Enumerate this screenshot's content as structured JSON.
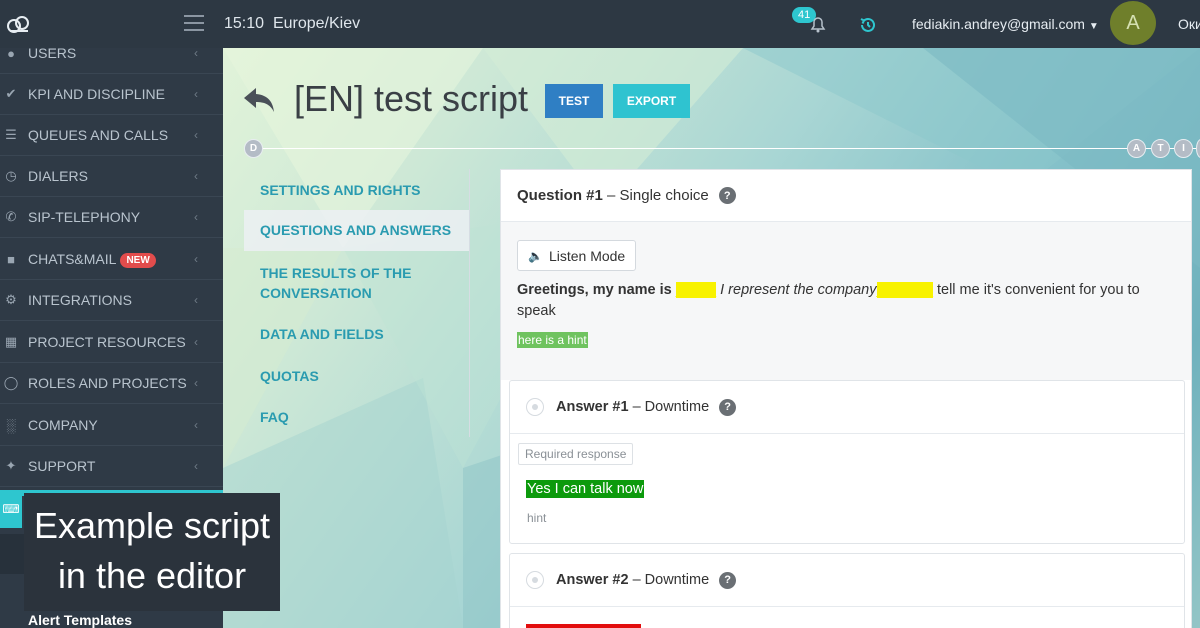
{
  "topbar": {
    "time": "15:10",
    "timezone": "Europe/Kiev",
    "notifications_count": "41",
    "user_email": "fediakin.andrey@gmail.com",
    "avatar_letter": "A",
    "extra_text": "Оки",
    "icons": [
      "cloud-logo-icon",
      "hamburger-icon",
      "bell-icon",
      "history-icon",
      "chevron-down-icon"
    ]
  },
  "sidebar": {
    "items": [
      {
        "label": "USERS",
        "icon": "user-icon"
      },
      {
        "label": "KPI AND DISCIPLINE",
        "icon": "check-icon"
      },
      {
        "label": "QUEUES AND CALLS",
        "icon": "list-icon"
      },
      {
        "label": "DIALERS",
        "icon": "clock-icon"
      },
      {
        "label": "SIP-TELEPHONY",
        "icon": "phone-icon"
      },
      {
        "label": "CHATS&MAIL",
        "icon": "chat-icon",
        "badge": "NEW"
      },
      {
        "label": "INTEGRATIONS",
        "icon": "gears-icon"
      },
      {
        "label": "PROJECT RESOURCES",
        "icon": "grid-icon"
      },
      {
        "label": "ROLES AND PROJECTS",
        "icon": "toggle-icon"
      },
      {
        "label": "COMPANY",
        "icon": "bar-chart-icon"
      },
      {
        "label": "SUPPORT",
        "icon": "wrench-icon"
      }
    ],
    "bottom_item": "Alert Templates"
  },
  "caption": {
    "line1": "Example script",
    "line2": "in the editor"
  },
  "header": {
    "title": "[EN] test script",
    "test_button": "TEST",
    "export_button": "EXPORT"
  },
  "timeline": {
    "start_label": "D",
    "end_labels": [
      "A",
      "T",
      "I"
    ]
  },
  "inner_nav": {
    "items": [
      "SETTINGS AND RIGHTS",
      "QUESTIONS AND ANSWERS",
      "THE RESULTS OF THE CONVERSATION",
      "DATA AND FIELDS",
      "QUOTAS",
      "FAQ"
    ],
    "active_index": 1
  },
  "question": {
    "title": "Question #1",
    "type": "– Single choice",
    "listen_mode": "Listen Mode",
    "text_bold": "Greetings, my name is",
    "blank1": "_____",
    "text_italic": "I represent the company",
    "blank2": "_______",
    "text_rest": "tell me it's convenient for you to speak",
    "hint": "here is a hint"
  },
  "answers": [
    {
      "title": "Answer #1",
      "subtitle": "– Downtime",
      "required": "Required response",
      "text": "Yes I can talk now",
      "hint": "hint"
    },
    {
      "title": "Answer #2",
      "subtitle": "– Downtime"
    }
  ],
  "colors": {
    "accent": "#2ec6cf",
    "test_button": "#2f7fc4",
    "export_button": "#2fc3d0",
    "nav_text": "#2a9bb0",
    "blank_highlight": "#f8f200",
    "hint_highlight": "#6fc35f",
    "answer1_highlight": "#0c9a0c",
    "answer2_highlight": "#e20d0d",
    "new_badge": "#e24c4c"
  }
}
